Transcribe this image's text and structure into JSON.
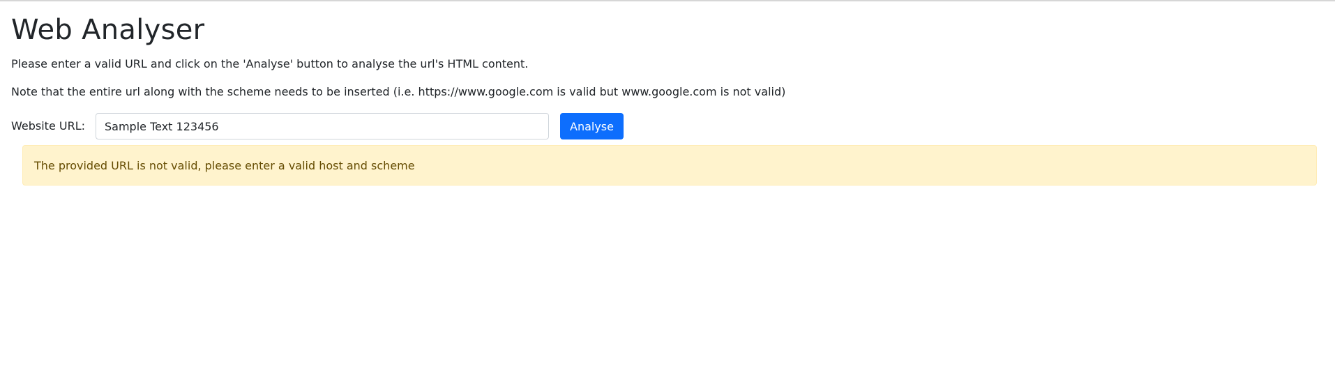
{
  "page": {
    "title": "Web Analyser",
    "instructions": "Please enter a valid URL and click on the 'Analyse' button to analyse the url's HTML content.",
    "note": "Note that the entire url along with the scheme needs to be inserted (i.e. https://www.google.com is valid but www.google.com is not valid)"
  },
  "form": {
    "url_label": "Website URL:",
    "url_value": "Sample Text 123456",
    "analyse_label": "Analyse"
  },
  "alert": {
    "message": "The provided URL is not valid, please enter a valid host and scheme"
  },
  "colors": {
    "primary": "#0d6efd",
    "warning_background": "#fff3cd",
    "warning_text": "#664d03",
    "text": "#212529"
  }
}
